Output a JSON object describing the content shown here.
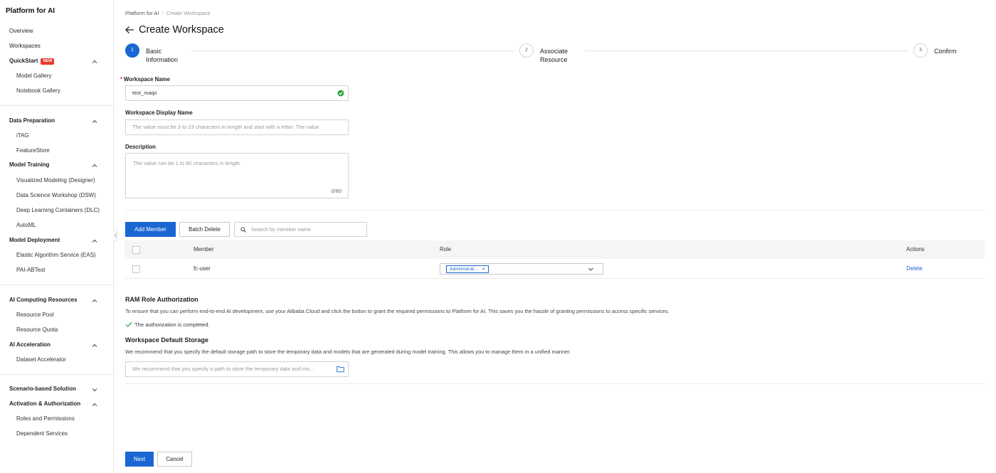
{
  "sidebar": {
    "brand": "Platform for AI",
    "overview": "Overview",
    "workspaces": "Workspaces",
    "quickstart": {
      "label": "QuickStart",
      "badge": "NEW",
      "items": [
        "Model Gallery",
        "Notebook Gallery"
      ]
    },
    "data_preparation": {
      "label": "Data Preparation",
      "items": [
        "iTAG",
        "FeatureStore"
      ]
    },
    "model_training": {
      "label": "Model Training",
      "items": [
        "Visualized Modeling (Designer)",
        "Data Science Workshop (DSW)",
        "Deep Learning Containers (DLC)",
        "AutoML"
      ]
    },
    "model_deployment": {
      "label": "Model Deployment",
      "items": [
        "Elastic Algorithm Service (EAS)",
        "PAI-ABTest"
      ]
    },
    "ai_computing": {
      "label": "AI Computing Resources",
      "items": [
        "Resource Pool",
        "Resource Quota"
      ]
    },
    "ai_acceleration": {
      "label": "AI Acceleration",
      "items": [
        "Dataset Accelerator"
      ]
    },
    "scenario": {
      "label": "Scenario-based Solution"
    },
    "activation": {
      "label": "Activation & Authorization",
      "items": [
        "Roles and Permissions",
        "Dependent Services"
      ]
    }
  },
  "breadcrumb": {
    "root": "Platform for AI",
    "separator": "/",
    "current": "Create Workspace"
  },
  "page_title": "Create Workspace",
  "steps": [
    {
      "number": "1",
      "line1": "Basic",
      "line2": "Information"
    },
    {
      "number": "2",
      "line1": "Associate",
      "line2": "Resource"
    },
    {
      "number": "3",
      "line1": "Confirm",
      "line2": ""
    }
  ],
  "form": {
    "name_label": "Workspace Name",
    "required_mark": "*",
    "name_value": "test_maipi",
    "display_name_label": "Workspace Display Name",
    "display_name_placeholder": "The value must be 3 to 23 characters in length and start with a letter. The value",
    "description_label": "Description",
    "description_placeholder": "The value can be 1 to 80 characters in length.",
    "description_count": "0/80"
  },
  "members": {
    "add_button": "Add Member",
    "batch_delete_button": "Batch Delete",
    "search_placeholder": "Search by member name",
    "columns": {
      "member": "Member",
      "role": "Role",
      "actions": "Actions"
    },
    "rows": [
      {
        "member": "fc-user",
        "role_tag": "Administrat...",
        "role_tag_close": "×",
        "action": "Delete"
      }
    ]
  },
  "ram": {
    "title": "RAM Role Authorization",
    "description": "To ensure that you can perform end-to-end AI development, use your Alibaba Cloud and click the button to grant the required permissions to Platform for AI. This saves you the hassle of granting permissions to access specific services.",
    "status": "The authorization is completed."
  },
  "storage": {
    "title": "Workspace Default Storage",
    "description": "We recommend that you specify the default storage path to store the temporary data and models that are generated during model training. This allows you to manage them in a unified manner.",
    "placeholder": "We recommend that you specify a path to store the temporary data and mo..."
  },
  "footer": {
    "next_button": "Next",
    "cancel_button": "Cancel"
  },
  "colors": {
    "primary": "#1a66d2",
    "success": "#2aa545",
    "required": "#e23b2e",
    "badge": "#e8382f"
  }
}
